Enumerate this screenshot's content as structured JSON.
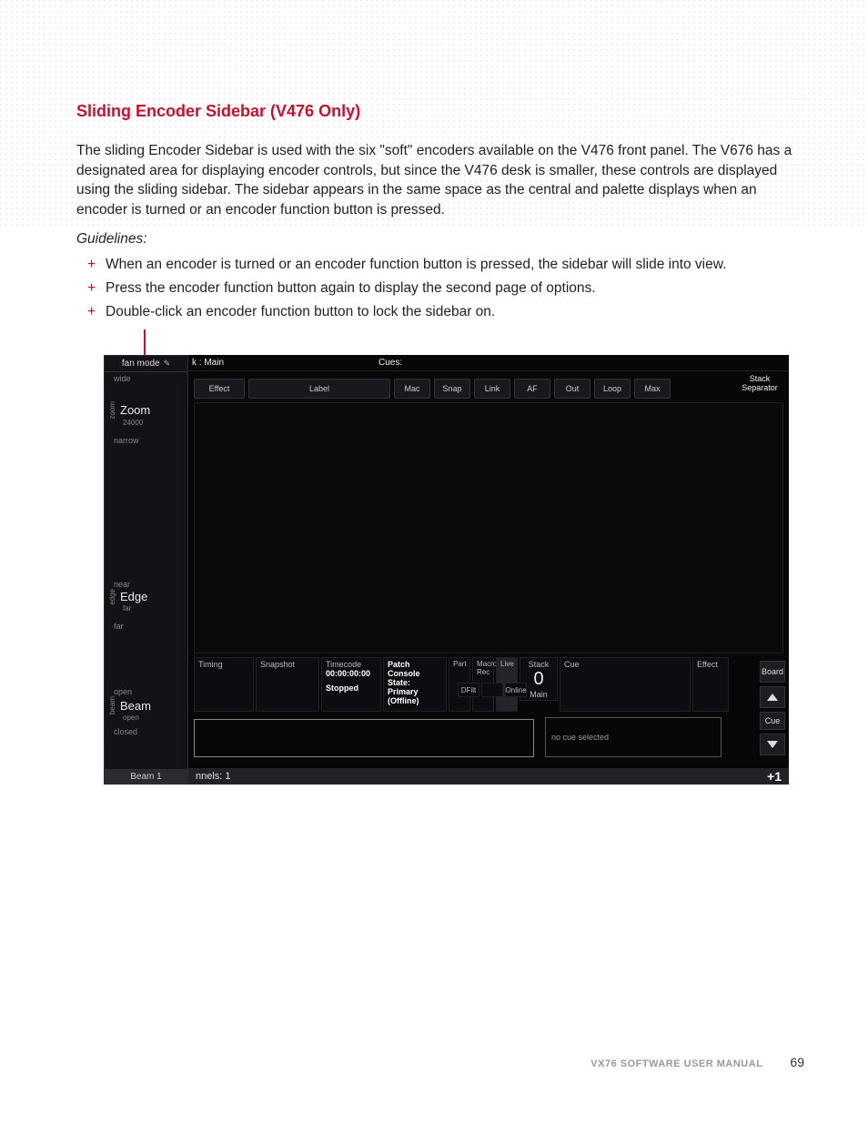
{
  "doc": {
    "heading": "Sliding Encoder Sidebar (V476 Only)",
    "paragraph": "The sliding Encoder Sidebar is used with the six \"soft\" encoders available on the V476 front panel. The V676 has a designated area for displaying encoder controls, but since the V476 desk is smaller, these controls are displayed using the sliding sidebar. The sidebar appears in the same space as the central and palette displays when an encoder is turned or an encoder function button is pressed.",
    "guidelines_label": "Guidelines:",
    "guidelines": [
      "When an encoder is turned or an encoder function button is pressed, the sidebar will slide into view.",
      "Press the encoder function button again to display the second page of options.",
      "Double-click an encoder function button to lock the sidebar on."
    ]
  },
  "console": {
    "sidebar": {
      "header": "fan mode",
      "encoders": [
        {
          "top": "wide",
          "side": "zoom",
          "name": "Zoom",
          "sub": "24000",
          "bot": "narrow"
        },
        {
          "top": "near",
          "side": "edge",
          "name": "Edge",
          "sub": "far",
          "bot": "far"
        },
        {
          "top": "open",
          "side": "beam",
          "name": "Beam",
          "sub": "open",
          "bot": "closed"
        }
      ],
      "page_label": "Beam 1"
    },
    "top": {
      "left": "k : Main",
      "cues": "Cues:"
    },
    "columns": [
      "Effect",
      "Label",
      "Mac",
      "Snap",
      "Link",
      "AF",
      "Out",
      "Loop",
      "Max"
    ],
    "stack_separator": "Stack Separator",
    "status": {
      "timing": "Timing",
      "snapshot": "Snapshot",
      "timecode_label": "Timecode",
      "timecode_value": "00:00:00:00",
      "timecode_status": "Stopped",
      "patch": "Patch",
      "console_state": "Console State:",
      "console_primary": "Primary",
      "console_offline": "(Offline)",
      "part": "Part",
      "macro_rec": "Macro Rec",
      "live": "Live",
      "dfilt": "DFilt",
      "online": "Online",
      "stack_label": "Stack",
      "stack_value": "0",
      "stack_main": "Main",
      "cue": "Cue",
      "no_cue": "no cue selected",
      "effect": "Effect",
      "board": "Board",
      "cue_btn": "Cue"
    },
    "bottombar": {
      "left": "nnels: 1",
      "right": "+1"
    }
  },
  "footer": {
    "manual": "VX76 SOFTWARE USER MANUAL",
    "page": "69"
  }
}
